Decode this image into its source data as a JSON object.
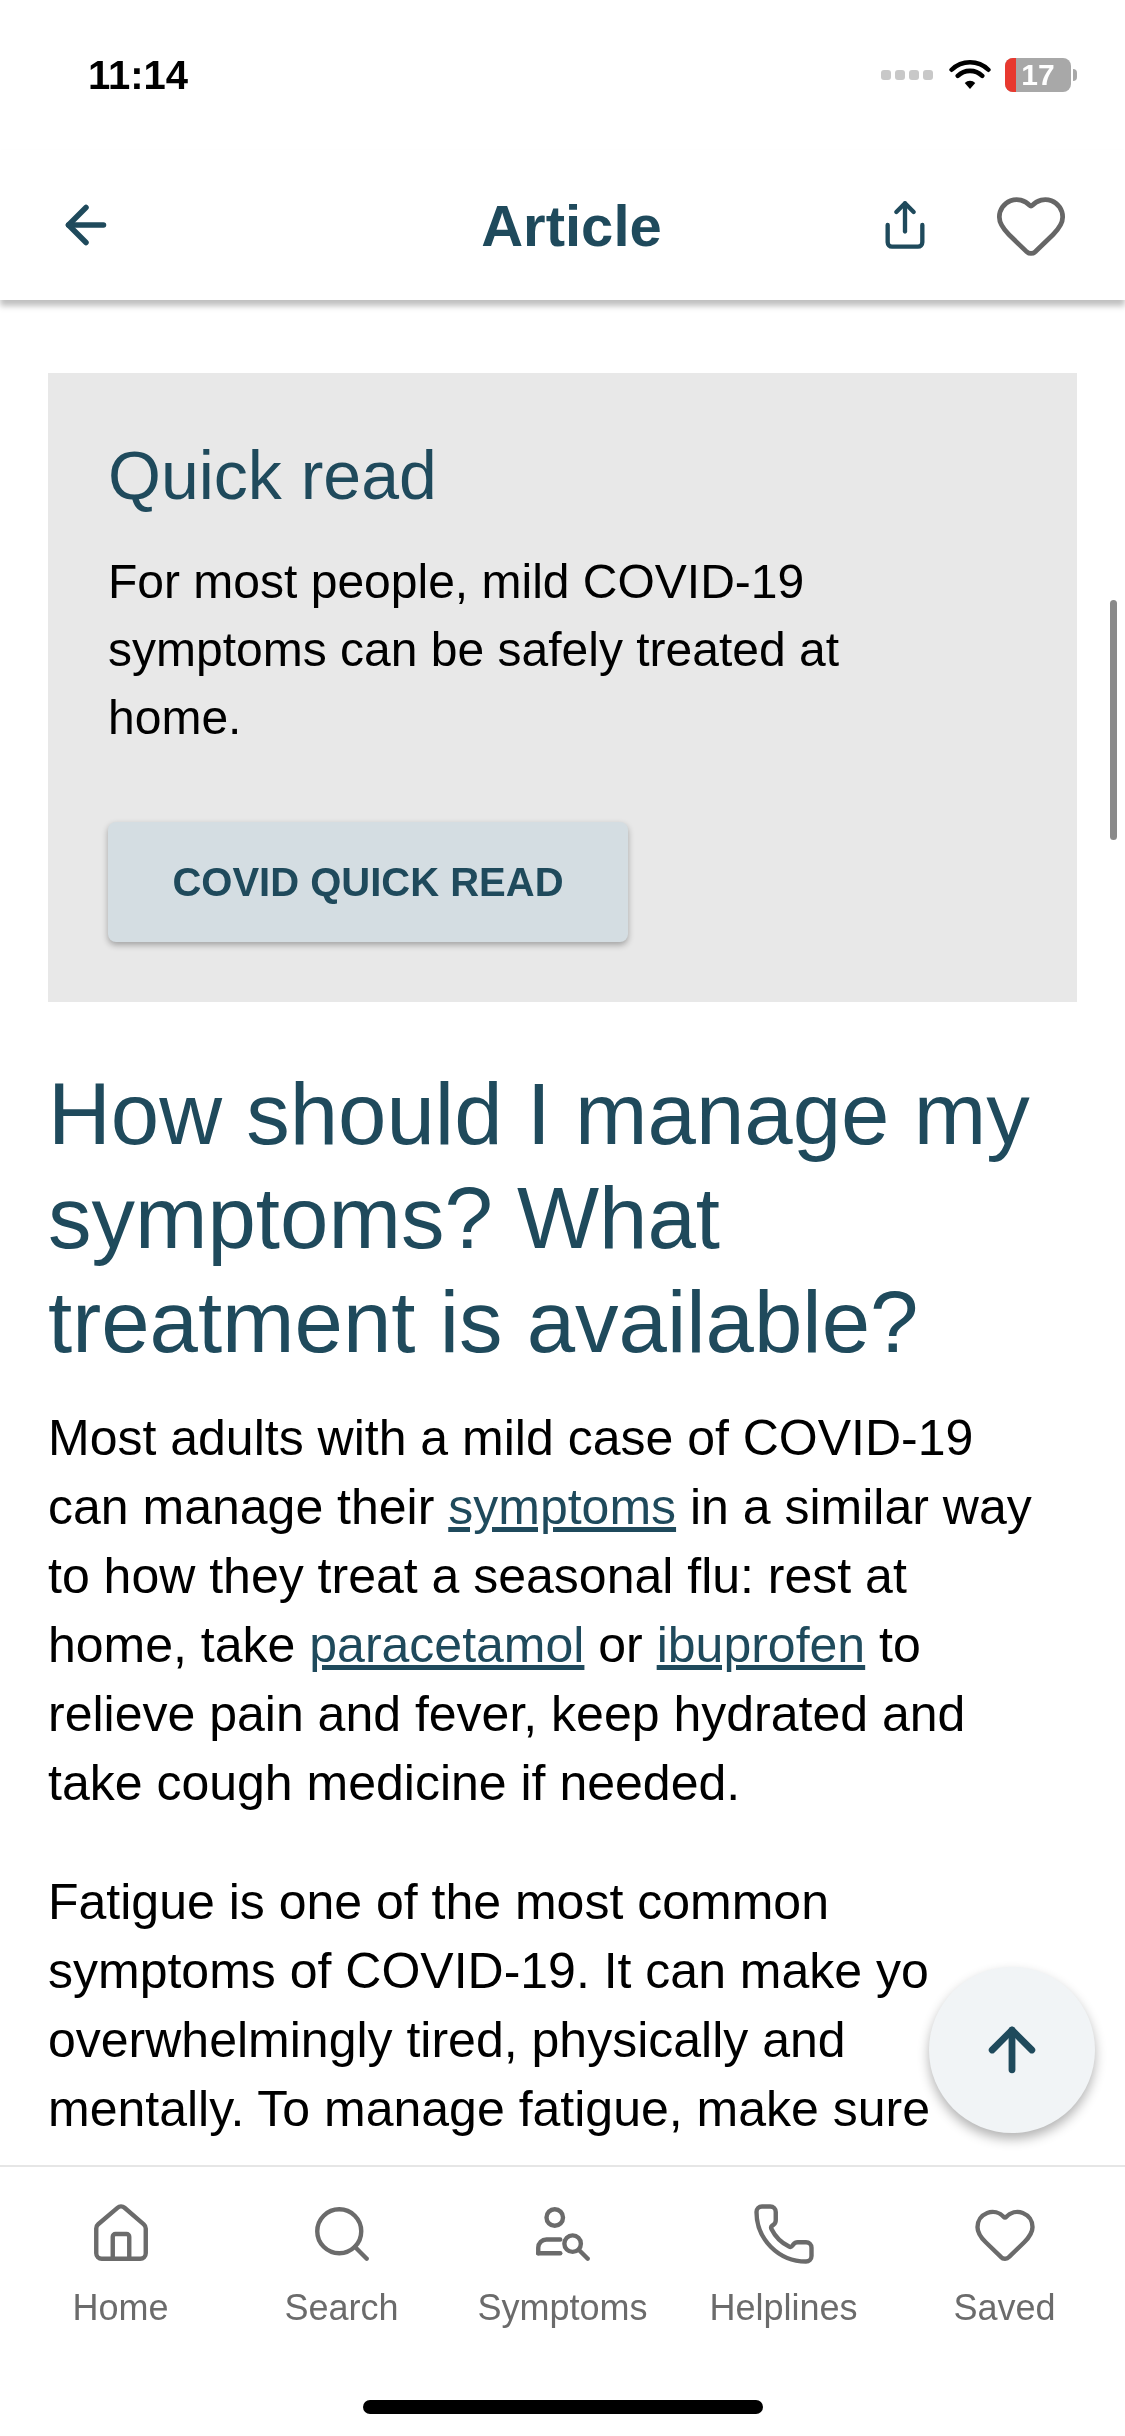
{
  "status_bar": {
    "time": "11:14",
    "battery": "17"
  },
  "header": {
    "title": "Article"
  },
  "quick_read": {
    "title": "Quick read",
    "text": "For most people, mild COVID-19 symptoms can be safely treated at home.",
    "button": "COVID QUICK READ"
  },
  "heading": "How should I manage my symptoms? What treatment is available?",
  "paragraphs": [
    [
      {
        "kind": "text",
        "text": "Most adults with a mild case of COVID-19 can manage their "
      },
      {
        "kind": "link",
        "text": "symptoms"
      },
      {
        "kind": "text",
        "text": " in a similar way to how they treat a seasonal flu: rest at home, take "
      },
      {
        "kind": "link",
        "text": "paracetamol"
      },
      {
        "kind": "text",
        "text": " or "
      },
      {
        "kind": "link",
        "text": "ibuprofen"
      },
      {
        "kind": "text",
        "text": " to relieve pain and fever, keep hydrated and take cough medicine if needed."
      }
    ],
    [
      {
        "kind": "line",
        "text": "Fatigue is one of the most common"
      },
      {
        "kind": "line",
        "text": "symptoms of COVID-19. It can make yo"
      },
      {
        "kind": "line",
        "text": "overwhelmingly tired, physically and"
      },
      {
        "kind": "line",
        "text": "mentally. To manage fatigue, make sure"
      }
    ]
  ],
  "tabs": [
    {
      "kind": "home",
      "label": "Home",
      "selected": false
    },
    {
      "kind": "search",
      "label": "Search",
      "selected": false
    },
    {
      "kind": "symptoms",
      "label": "Symptoms",
      "selected": false
    },
    {
      "kind": "helplines",
      "label": "Helplines",
      "selected": false
    },
    {
      "kind": "saved",
      "label": "Saved",
      "selected": false
    }
  ]
}
